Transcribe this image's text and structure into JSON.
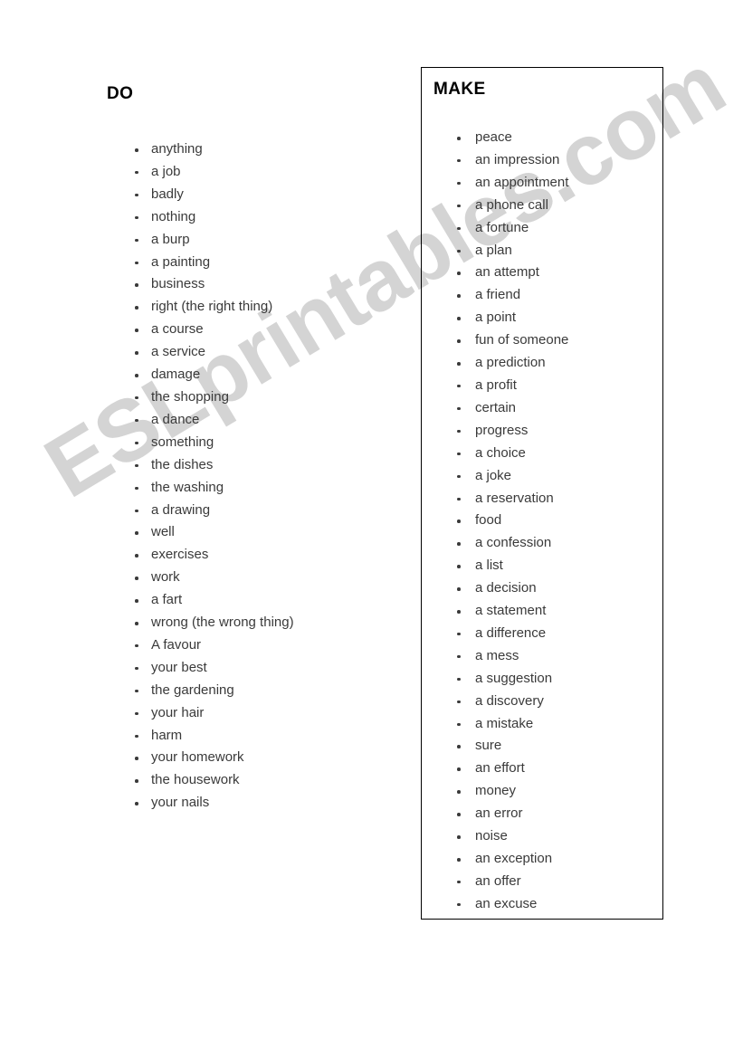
{
  "watermark": {
    "text": "ESLprintables.com",
    "color": "#d4d4d4"
  },
  "columns": {
    "do": {
      "heading": "DO",
      "items": [
        "anything",
        "a job",
        "badly",
        "nothing",
        "a burp",
        "a painting",
        "business",
        "right (the right thing)",
        "a course",
        "a service",
        "damage",
        "the shopping",
        "a dance",
        "something",
        "the dishes",
        "the washing",
        "a drawing",
        "well",
        "exercises",
        "work",
        "a fart",
        "wrong (the wrong thing)",
        "A favour",
        "your best",
        "the gardening",
        "your hair",
        "harm",
        "your homework",
        "the housework",
        "your nails"
      ]
    },
    "make": {
      "heading": "MAKE",
      "items": [
        "peace",
        "an impression",
        "an appointment",
        "a phone call",
        "a fortune",
        "a plan",
        "an attempt",
        "a friend",
        "a point",
        "fun of someone",
        "a prediction",
        "a profit",
        "certain",
        "progress",
        "a choice",
        "a joke",
        "a reservation",
        "food",
        "a confession",
        "a list",
        "a decision",
        "a statement",
        "a difference",
        "a mess",
        "a suggestion",
        "a discovery",
        "a mistake",
        "sure",
        "an effort",
        "money",
        "an error",
        "noise",
        "an exception",
        "an offer",
        "an excuse"
      ]
    }
  }
}
